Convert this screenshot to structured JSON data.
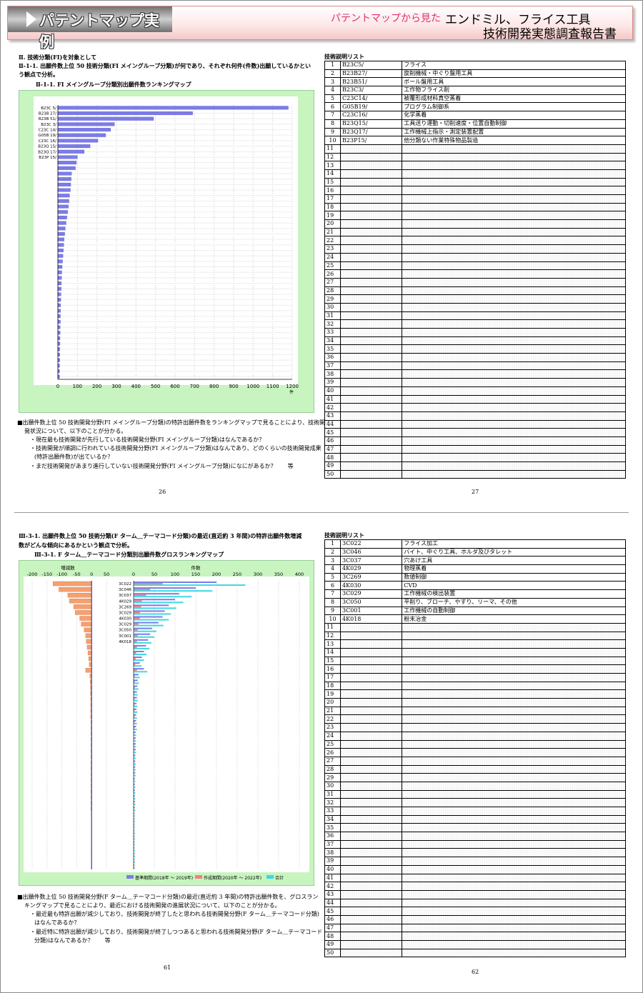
{
  "header": {
    "title": "パテントマップ実例",
    "subtitle": "パテントマップから見た",
    "report_line1": "エンドミル、フライス工具",
    "report_line2": "技術開発実態調査報告書"
  },
  "page_top_left": {
    "heading": "Ⅱ. 技術分類(FI)を対象として",
    "subheading_line1": "Ⅱ-1-1. 出願件数上位 50 技術分類(FI メイングループ分類)が何であり、それぞれ何件(件数)出願しているかとい",
    "subheading_line2": "う観点で分析。",
    "chart_title": "Ⅱ-1-1. FI メイングループ分類別出願件数ランキングマップ",
    "desc_line1": "■出願件数上位 50 技術開発分野(FI メイングループ分類)の特許出願件数をランキングマップで見ることにより、技術開",
    "desc_line2": "発状況について、以下のことが分かる。",
    "bullet1": "・現在最も技術開発が先行している技術開発分野(FI メイングループ分類)はなんであるか？",
    "bullet2": "・技術開発が順調に行われている技術開発分野(FI メイングループ分類)はなんであり、どのくらいの技術開発成果",
    "bullet2b": "(特許出願件数)が出ているか？",
    "bullet3": "・まだ技術開発があまり進行していない技術開発分野(FI メイングループ分類)になにがあるか？　　等",
    "page_number": "26"
  },
  "page_top_right": {
    "list_title": "技術説明リスト",
    "rows": [
      {
        "no": "1",
        "code": "B23C5/",
        "desc": "フライス"
      },
      {
        "no": "2",
        "code": "B23B27/",
        "desc": "旋削機械・中ぐり盤用工具"
      },
      {
        "no": "3",
        "code": "B23B51/",
        "desc": "ボール盤用工具"
      },
      {
        "no": "4",
        "code": "B23C3/",
        "desc": "工作物フライス削"
      },
      {
        "no": "5",
        "code": "C23C14/",
        "desc": "被覆形成材料真空蒸着"
      },
      {
        "no": "6",
        "code": "G05B19/",
        "desc": "プログラム制御系"
      },
      {
        "no": "7",
        "code": "C23C16/",
        "desc": "化学蒸着"
      },
      {
        "no": "8",
        "code": "B23Q15/",
        "desc": "工具送り運動・切削速度・位置自動制御"
      },
      {
        "no": "9",
        "code": "B23Q17/",
        "desc": "工作機械上指示・測定装置配置"
      },
      {
        "no": "10",
        "code": "B23P15/",
        "desc": "他分類ない作業特殊物品製造"
      }
    ],
    "empty_numbers": [
      "11",
      "12",
      "13",
      "14",
      "15",
      "16",
      "17",
      "18",
      "19",
      "20",
      "21",
      "22",
      "23",
      "24",
      "25",
      "26",
      "27",
      "28",
      "29",
      "30",
      "31",
      "32",
      "33",
      "34",
      "35",
      "36",
      "37",
      "38",
      "39",
      "40",
      "41",
      "42",
      "43",
      "44",
      "45",
      "46",
      "47",
      "48",
      "49",
      "50"
    ],
    "page_number": "27"
  },
  "page_bottom_left": {
    "heading_line1": "Ⅲ-3-1. 出願件数上位 50 技術分類(F ターム＿テーマコード分類)の最近(直近約 3 年間)の特許出願件数増減",
    "heading_line2": "数がどんな傾向にあるかという観点で分析。",
    "chart_title": "Ⅲ-3-1. F ターム＿テーマコード分類別出願件数グロスランキングマップ",
    "desc_line1": "■出願件数上位 50 技術開発分野(F ターム＿テーマコード分類)の最近(直近約 3 年間)の特許出願件数を、グロスラン",
    "desc_line2": "キングマップで見ることにより、最近における技術開発の進展状況について、以下のことが分かる。",
    "bullet1": "・最近最も特許出願が減少しており、技術開発が終了したと思われる技術開発分野(F ターム＿テーマコード分類)",
    "bullet1b": "はなんであるか？",
    "bullet2": "・最近特に特許出願が減少しており、技術開発が終了しつつあると思われる技術開発分野(F ターム＿テーマコード",
    "bullet2b": "分類)はなんであるか？　　等",
    "page_number": "61"
  },
  "page_bottom_right": {
    "list_title": "技術説明リスト",
    "rows": [
      {
        "no": "1",
        "code": "3C022",
        "desc": "フライス加工"
      },
      {
        "no": "2",
        "code": "3C046",
        "desc": "バイト、中ぐり工具、ホルダ及びタレット"
      },
      {
        "no": "3",
        "code": "3C037",
        "desc": "穴あけ工具"
      },
      {
        "no": "4",
        "code": "4K029",
        "desc": "物理蒸着"
      },
      {
        "no": "5",
        "code": "3C269",
        "desc": "数値制御"
      },
      {
        "no": "6",
        "code": "4K030",
        "desc": "CVD"
      },
      {
        "no": "7",
        "code": "3C029",
        "desc": "工作機械の検出装置"
      },
      {
        "no": "8",
        "code": "3C050",
        "desc": "平削り、ブローチ、やすり、リーマ、その他"
      },
      {
        "no": "9",
        "code": "3C001",
        "desc": "工作機械の自動制御"
      },
      {
        "no": "10",
        "code": "4K018",
        "desc": "粉末冶金"
      }
    ],
    "empty_numbers": [
      "11",
      "12",
      "13",
      "14",
      "15",
      "16",
      "17",
      "18",
      "19",
      "20",
      "21",
      "22",
      "23",
      "24",
      "25",
      "26",
      "27",
      "28",
      "29",
      "30",
      "31",
      "32",
      "33",
      "34",
      "35",
      "36",
      "37",
      "38",
      "39",
      "40",
      "41",
      "42",
      "43",
      "44",
      "45",
      "46",
      "47",
      "48",
      "49",
      "50"
    ],
    "page_number": "62"
  },
  "chart_data": [
    {
      "type": "bar",
      "orientation": "horizontal",
      "title": "",
      "xlabel": "件",
      "xlim": [
        0,
        1200
      ],
      "xticks": [
        "0",
        "100",
        "200",
        "300",
        "400",
        "500",
        "600",
        "700",
        "800",
        "900",
        "1000",
        "1100",
        "1200"
      ],
      "categories": [
        "B23C 5/",
        "B23B 27/",
        "B23B 51/",
        "B23C 3/",
        "C23C 14/",
        "G05B 19/",
        "C23C 16/",
        "B23Q 15/",
        "B23Q 17/",
        "B23P 15/"
      ],
      "values": [
        1180,
        690,
        490,
        290,
        270,
        245,
        205,
        165,
        135,
        100,
        95,
        90,
        70,
        68,
        66,
        64,
        60,
        57,
        54,
        50,
        46,
        42,
        38,
        35,
        32,
        30,
        28,
        26,
        24,
        22,
        20,
        19,
        18,
        17,
        16,
        15,
        14,
        14,
        13,
        13,
        12,
        12,
        11,
        11,
        10,
        10,
        10,
        9,
        9,
        9
      ],
      "colors": {
        "bar": "#7c7ce8",
        "grid": "#c8c8c8"
      }
    },
    {
      "type": "bar",
      "orientation": "horizontal",
      "title": "",
      "left_panel": {
        "xlabel": "増減数",
        "xlim": [
          -200,
          50
        ],
        "xticks": [
          "-200",
          "-150",
          "-100",
          "-50",
          "0",
          "50"
        ]
      },
      "right_panel": {
        "xlabel": "件数",
        "xlim": [
          0,
          400
        ],
        "xticks": [
          "0",
          "50",
          "100",
          "150",
          "200",
          "250",
          "300",
          "350",
          "400"
        ]
      },
      "categories": [
        "3C022",
        "3C046",
        "3C037",
        "4K029",
        "3C269",
        "3C029",
        "4K030",
        "3C029",
        "3C050",
        "3C001",
        "4K018"
      ],
      "legend": [
        "基準期間(2018年 ～ 2019年)",
        "作成期間(2020年 ～ 2022年)",
        "合計"
      ],
      "series": [
        {
          "name": "基準期間(2018年 ～ 2019年)",
          "values": [
            200,
            150,
            110,
            100,
            85,
            75,
            70,
            60,
            45,
            40,
            35,
            30,
            25,
            20,
            15,
            25,
            12,
            10,
            9,
            8,
            8,
            7,
            7,
            6,
            6,
            6,
            5,
            5,
            5,
            5,
            4,
            4,
            4,
            4,
            3,
            3,
            3,
            3,
            3,
            3,
            2,
            2,
            2,
            2,
            2,
            2,
            2,
            2,
            2,
            2
          ]
        },
        {
          "name": "作成期間(2020年 ～ 2022年)",
          "values": [
            70,
            40,
            30,
            20,
            18,
            15,
            15,
            12,
            10,
            10,
            8,
            8,
            6,
            5,
            4,
            8,
            3,
            3,
            3,
            2,
            2,
            2,
            2,
            2,
            2,
            2,
            1,
            1,
            1,
            1,
            1,
            1,
            1,
            1,
            1,
            1,
            1,
            1,
            1,
            1,
            1,
            1,
            1,
            1,
            1,
            1,
            1,
            1,
            1,
            1
          ]
        },
        {
          "name": "合計",
          "values": [
            270,
            190,
            140,
            120,
            103,
            90,
            85,
            72,
            55,
            50,
            43,
            38,
            31,
            25,
            19,
            33,
            15,
            13,
            12,
            10,
            10,
            9,
            9,
            8,
            8,
            8,
            6,
            6,
            6,
            6,
            5,
            5,
            5,
            5,
            4,
            4,
            4,
            4,
            4,
            4,
            3,
            3,
            3,
            3,
            3,
            3,
            3,
            3,
            3,
            3
          ]
        },
        {
          "name": "増減数",
          "values": [
            -130,
            -110,
            -80,
            -75,
            -60,
            -55,
            -40,
            -35,
            -25,
            -20,
            -18,
            -15,
            -12,
            -10,
            -8,
            -20,
            -6,
            -5,
            -4,
            -4,
            -3,
            -3,
            -3,
            -3,
            -2,
            -2,
            -2,
            -2,
            -2,
            -2,
            -2,
            -2,
            -2,
            -2,
            -2,
            -2,
            -2,
            -2,
            -2,
            -2,
            -1,
            -1,
            -1,
            -1,
            -1,
            -1,
            -1,
            -1,
            -1,
            -1
          ]
        }
      ],
      "colors": {
        "base": "#7c7ce8",
        "recent": "#f08080",
        "total": "#40d8e0",
        "delta": "#f4a070"
      }
    }
  ]
}
